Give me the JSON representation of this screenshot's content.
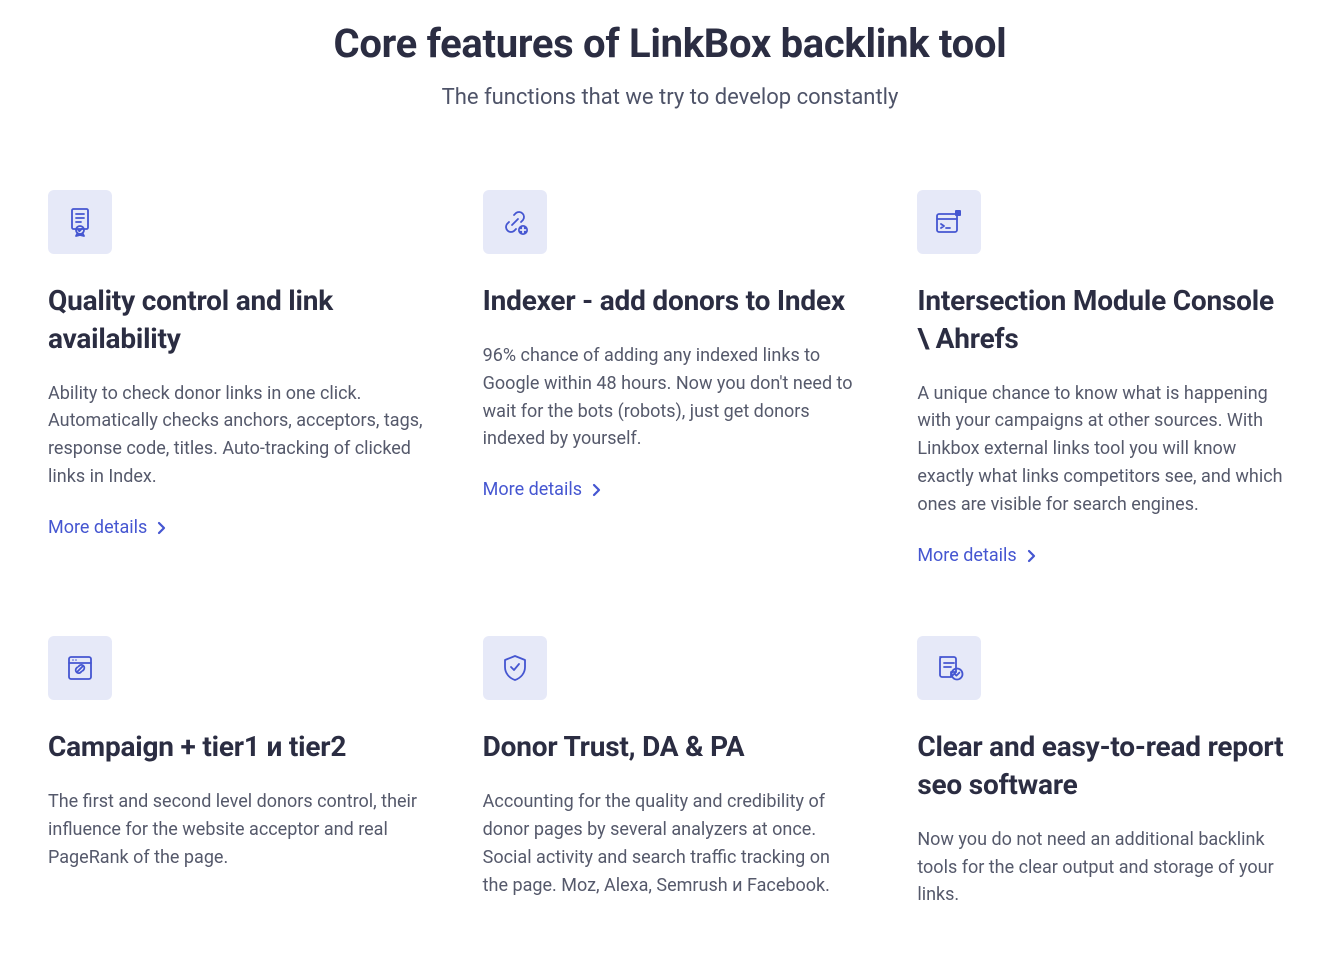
{
  "header": {
    "title": "Core features of LinkBox backlink tool",
    "subtitle": "The functions that we try to develop constantly"
  },
  "features": [
    {
      "title": "Quality control and link availability",
      "description": "Ability to check donor links in one click. Automatically checks anchors, acceptors, tags, response code, titles. Auto-tracking of clicked links in Index.",
      "more": "More details"
    },
    {
      "title": "Indexer - add donors to Index",
      "description": "96% chance of adding any indexed links to Google within 48 hours. Now you don't need to wait for the bots (robots), just get donors indexed by yourself.",
      "more": "More details"
    },
    {
      "title": "Intersection Module Console \\ Ahrefs",
      "description": "A unique chance to know what is happening with your campaigns at other sources. With Linkbox external links tool you will know exactly what links competitors see, and which ones are visible for search engines.",
      "more": "More details"
    },
    {
      "title": "Campaign + tier1 и tier2",
      "description": "The first and second level donors control, their influence for the website acceptor and real PageRank of the page.",
      "more": ""
    },
    {
      "title": "Donor Trust, DA & PA",
      "description": "Accounting for the quality and credibility of donor pages by several analyzers at once. Social activity and search traffic tracking on the page. Moz, Alexa, Semrush и Facebook.",
      "more": ""
    },
    {
      "title": "Clear and easy-to-read report seo software",
      "description": "Now you do not need an additional backlink tools for the clear output and storage of your links.",
      "more": ""
    }
  ]
}
